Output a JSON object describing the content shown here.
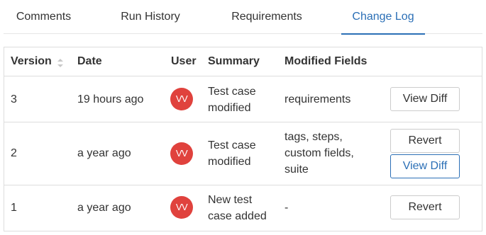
{
  "tabs": [
    {
      "label": "Comments"
    },
    {
      "label": "Run History"
    },
    {
      "label": "Requirements"
    },
    {
      "label": "Change Log",
      "active": true
    }
  ],
  "table": {
    "columns": [
      "Version",
      "Date",
      "User",
      "Summary",
      "Modified Fields"
    ],
    "rows": [
      {
        "version": "3",
        "date": "19 hours ago",
        "user_initials": "VV",
        "summary": [
          "Test case",
          "modified"
        ],
        "modified_fields": [
          "requirements"
        ],
        "actions": [
          "View Diff"
        ]
      },
      {
        "version": "2",
        "date": "a year ago",
        "user_initials": "VV",
        "summary": [
          "Test case",
          "modified"
        ],
        "modified_fields": [
          "tags, steps,",
          "custom fields,",
          "suite"
        ],
        "actions": [
          "Revert",
          "View Diff"
        ]
      },
      {
        "version": "1",
        "date": "a year ago",
        "user_initials": "VV",
        "summary": [
          "New test",
          "case added"
        ],
        "modified_fields": [
          "-"
        ],
        "actions": [
          "Revert"
        ]
      }
    ]
  },
  "colors": {
    "accent": "#2b6fb6",
    "avatar": "#e0423d",
    "border": "#dddddd"
  },
  "icons": {
    "sort": "sort-updown-icon"
  }
}
